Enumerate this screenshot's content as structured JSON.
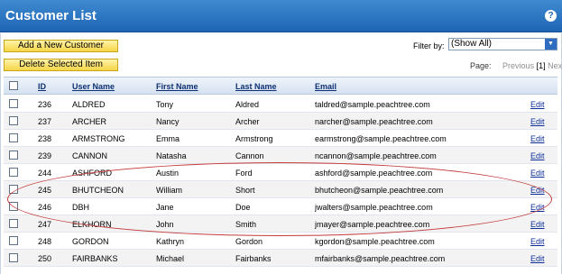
{
  "window": {
    "title": "Customer List",
    "help_label": "?"
  },
  "toolbar": {
    "add_label": "Add a New Customer",
    "delete_label": "Delete Selected Item"
  },
  "filter": {
    "label": "Filter by:",
    "selected": "(Show All)"
  },
  "pager": {
    "label": "Page:",
    "previous": "Previous",
    "current": "[1]",
    "next": "Next"
  },
  "table": {
    "columns": [
      "ID",
      "User Name",
      "First Name",
      "Last Name",
      "Email"
    ],
    "edit_label": "Edit",
    "rows": [
      {
        "id": "236",
        "username": "ALDRED",
        "first": "Tony",
        "last": "Aldred",
        "email": "taldred@sample.peachtree.com"
      },
      {
        "id": "237",
        "username": "ARCHER",
        "first": "Nancy",
        "last": "Archer",
        "email": "narcher@sample.peachtree.com"
      },
      {
        "id": "238",
        "username": "ARMSTRONG",
        "first": "Emma",
        "last": "Armstrong",
        "email": "earmstrong@sample.peachtree.com"
      },
      {
        "id": "239",
        "username": "CANNON",
        "first": "Natasha",
        "last": "Cannon",
        "email": "ncannon@sample.peachtree.com"
      },
      {
        "id": "244",
        "username": "ASHFORD",
        "first": "Austin",
        "last": "Ford",
        "email": "ashford@sample.peachtree.com"
      },
      {
        "id": "245",
        "username": "BHUTCHEON",
        "first": "William",
        "last": "Short",
        "email": "bhutcheon@sample.peachtree.com"
      },
      {
        "id": "246",
        "username": "DBH",
        "first": "Jane",
        "last": "Doe",
        "email": "jwalters@sample.peachtree.com"
      },
      {
        "id": "247",
        "username": "ELKHORN",
        "first": "John",
        "last": "Smith",
        "email": "jmayer@sample.peachtree.com"
      },
      {
        "id": "248",
        "username": "GORDON",
        "first": "Kathryn",
        "last": "Gordon",
        "email": "kgordon@sample.peachtree.com"
      },
      {
        "id": "250",
        "username": "FAIRBANKS",
        "first": "Michael",
        "last": "Fairbanks",
        "email": "mfairbanks@sample.peachtree.com"
      }
    ]
  },
  "colors": {
    "titlebar": "#1e65b4",
    "button": "#f6d547",
    "annotation": "#c43b3b",
    "link": "#0d2f99"
  }
}
